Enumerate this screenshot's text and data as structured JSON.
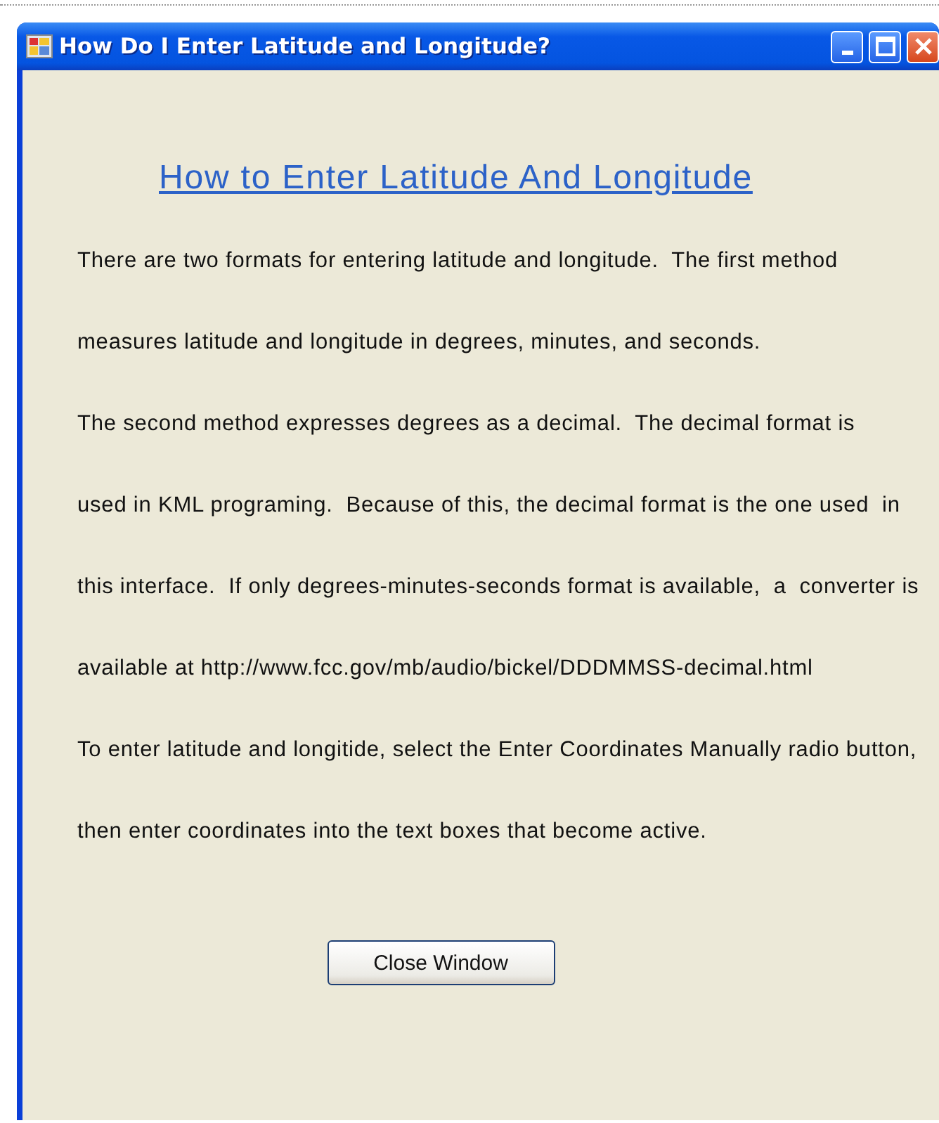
{
  "window": {
    "title": "How Do I Enter Latitude and Longitude?"
  },
  "heading": "How to Enter Latitude And Longitude",
  "lines": [
    "There are two formats for entering latitude and longitude.  The first method",
    "measures latitude and longitude in degrees, minutes, and seconds.",
    "The second method expresses degrees as a decimal.  The decimal format is",
    "used in KML programing.  Because of this, the decimal format is the one used  in",
    "this interface.  If only degrees-minutes-seconds format is available,  a  converter is",
    "available at http://www.fcc.gov/mb/audio/bickel/DDDMMSS-decimal.html",
    "To enter latitude and longitide, select the Enter Coordinates Manually radio button,",
    "then enter coordinates into the text boxes that become active."
  ],
  "buttons": [
    "Close Window"
  ]
}
